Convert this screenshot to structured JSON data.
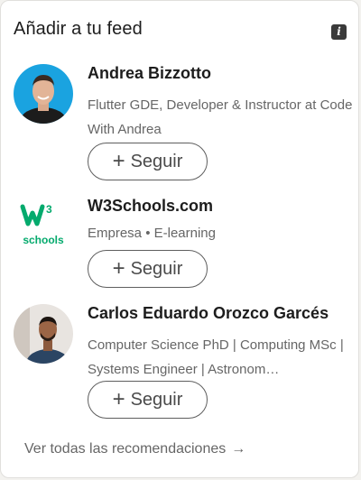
{
  "header": {
    "title": "Añadir a tu feed",
    "info_icon": "info-icon"
  },
  "recommendations": [
    {
      "name": "Andrea Bizzotto",
      "subtitle": "Flutter GDE, Developer & Instructor at Code With Andrea",
      "button_label": "Seguir"
    },
    {
      "name": "W3Schools.com",
      "subtitle": "Empresa • E-learning",
      "button_label": "Seguir",
      "logo_text": "schools"
    },
    {
      "name": "Carlos Eduardo Orozco Garcés",
      "subtitle": "Computer Science PhD | Computing MSc | Systems Engineer | Astronom…",
      "button_label": "Seguir"
    }
  ],
  "footer": {
    "link_label": "Ver todas las recomendaciones",
    "arrow_icon": "→"
  },
  "colors": {
    "card_bg": "#ffffff",
    "page_bg": "#f3f2ef",
    "text_primary": "#1d1d1d",
    "text_secondary": "#666666",
    "w3_green": "#04aa6d"
  }
}
